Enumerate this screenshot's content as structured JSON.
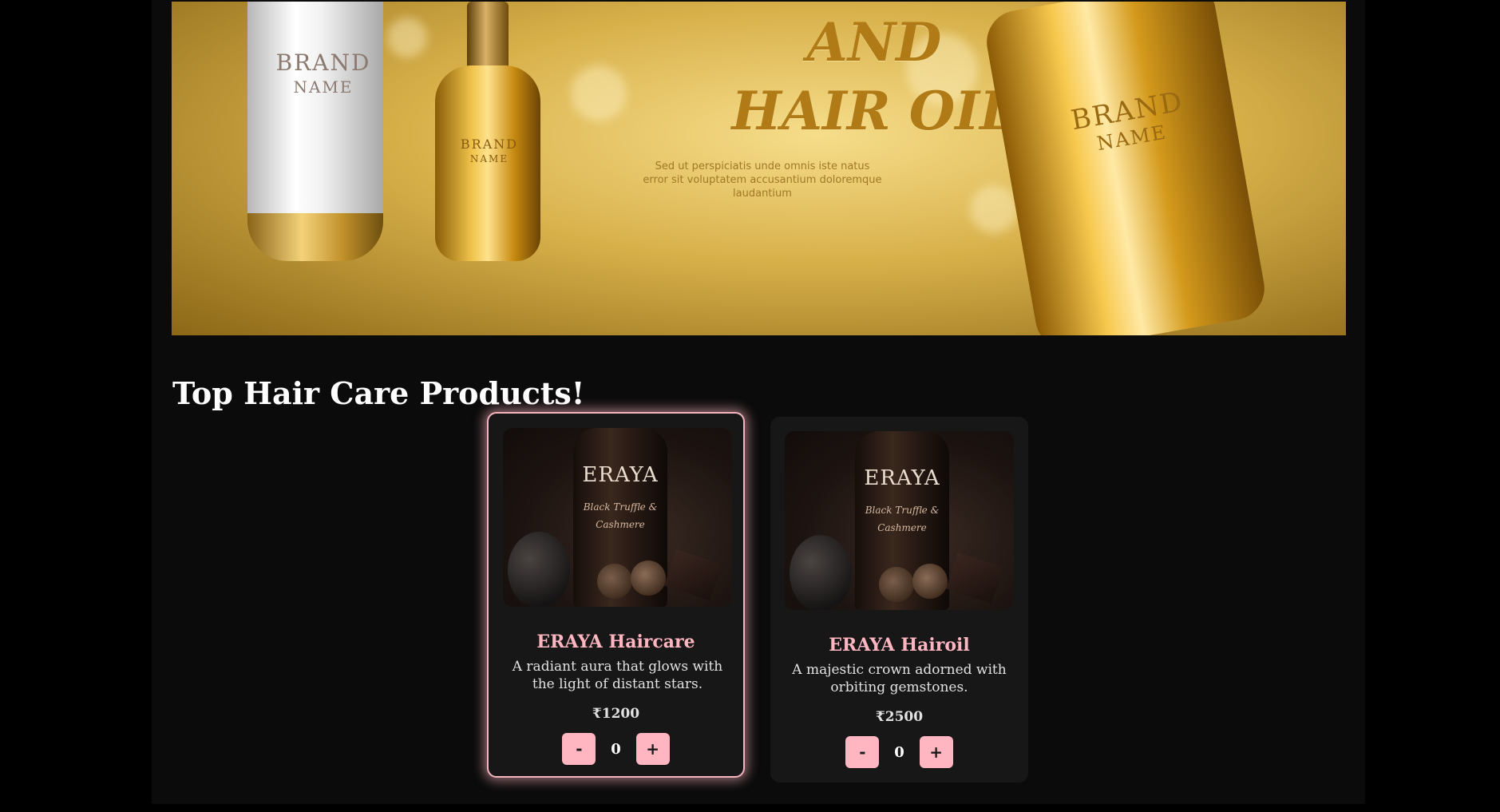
{
  "banner": {
    "headline_line1": "AND",
    "headline_line2": "HAIR OIL",
    "tagline": "Sed ut perspiciatis unde omnis iste natus error sit voluptatem accusantium doloremque laudantium",
    "bottle_label_brand": "BRAND",
    "bottle_label_name": "NAME"
  },
  "section": {
    "title": "Top Hair Care Products!"
  },
  "products": [
    {
      "brand_mark": "ERAYA",
      "image_text": "Black Truffle & Cashmere",
      "name": "ERAYA Haircare",
      "description": "A radiant aura that glows with the light of distant stars.",
      "price": "₹1200",
      "minus_label": "-",
      "plus_label": "+",
      "quantity": "0"
    },
    {
      "brand_mark": "ERAYA",
      "image_text": "Black Truffle & Cashmere",
      "name": "ERAYA Hairoil",
      "description": "A majestic crown adorned with orbiting gemstones.",
      "price": "₹2500",
      "minus_label": "-",
      "plus_label": "+",
      "quantity": "0"
    }
  ],
  "colors": {
    "accent_pink": "#ffb6c1",
    "page_background": "#0b0b0b",
    "card_background": "#171717"
  }
}
